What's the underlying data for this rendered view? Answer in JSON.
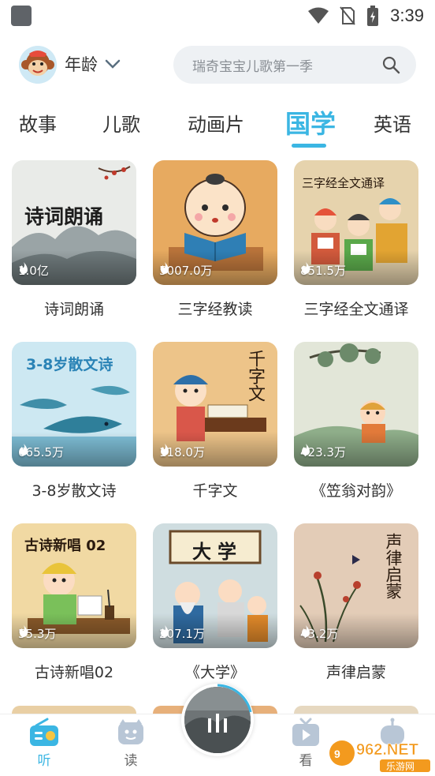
{
  "status_bar": {
    "time": "3:39"
  },
  "header": {
    "age_label": "年龄",
    "search_placeholder": "瑞奇宝宝儿歌第一季"
  },
  "tabs": [
    {
      "label": "故事"
    },
    {
      "label": "儿歌"
    },
    {
      "label": "动画片"
    },
    {
      "label": "国学",
      "active": true
    },
    {
      "label": "英语"
    }
  ],
  "cards": [
    {
      "title": "诗词朗诵",
      "count": "1.0亿",
      "cover_text": "诗词朗诵"
    },
    {
      "title": "三字经教读",
      "count": "5007.0万",
      "cover_text": ""
    },
    {
      "title": "三字经全文通译",
      "count": "851.5万",
      "cover_text": "三字经全文通译"
    },
    {
      "title": "3-8岁散文诗",
      "count": "665.5万",
      "cover_text": "3-8岁散文诗"
    },
    {
      "title": "千字文",
      "count": "118.0万",
      "cover_text": "千字文"
    },
    {
      "title": "《笠翁对韵》",
      "count": "423.3万",
      "cover_text": ""
    },
    {
      "title": "古诗新唱02",
      "count": "55.3万",
      "cover_text": "古诗新唱 02"
    },
    {
      "title": "《大学》",
      "count": "207.1万",
      "cover_text": "大学"
    },
    {
      "title": "声律启蒙",
      "count": "43.2万",
      "cover_text": "声律启蒙"
    }
  ],
  "bottom_nav": [
    {
      "label": "听",
      "active": true
    },
    {
      "label": "读"
    },
    {
      "label": ""
    },
    {
      "label": "看"
    },
    {
      "label": ""
    }
  ],
  "watermark": {
    "text": "962.NET",
    "subtext": "乐游网"
  },
  "colors": {
    "accent": "#3bb6e3",
    "text": "#333333",
    "search_bg": "#eef1f4"
  }
}
